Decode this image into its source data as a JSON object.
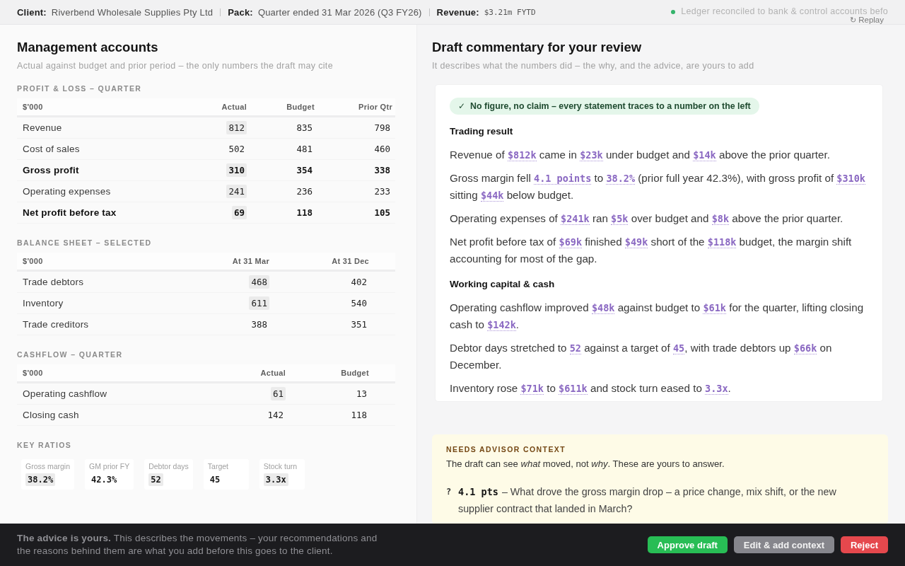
{
  "header": {
    "fields": [
      {
        "label": "Client:",
        "value": "Riverbend Wholesale Supplies Pty Ltd",
        "kind": "text"
      },
      {
        "label": "Pack:",
        "value": "Quarter ended 31 Mar 2026 (Q3 FY26)",
        "kind": "text"
      },
      {
        "label": "Revenue:",
        "value": "$3.21m FYTD",
        "kind": "mono"
      }
    ],
    "status": "Ledger reconciled to bank & control accounts befo",
    "replay": {
      "icon": "↻",
      "label": "Replay"
    }
  },
  "accounts": {
    "title": "Management accounts",
    "subtitle": "Actual against budget and prior period – the only numbers the draft may cite",
    "tables": [
      {
        "title": "PROFIT & LOSS – QUARTER",
        "stub_header": "$'000",
        "columns": [
          "Actual",
          "Budget",
          "Prior Qtr"
        ],
        "rows": [
          {
            "label": "Revenue",
            "kind": "line",
            "cells": [
              {
                "value": "812",
                "highlighted": true
              },
              {
                "value": "835",
                "highlighted": false
              },
              {
                "value": "798",
                "highlighted": false
              }
            ]
          },
          {
            "label": "Cost of sales",
            "kind": "line",
            "cells": [
              {
                "value": "502",
                "highlighted": false
              },
              {
                "value": "481",
                "highlighted": false
              },
              {
                "value": "460",
                "highlighted": false
              }
            ]
          },
          {
            "label": "Gross profit",
            "kind": "total",
            "cells": [
              {
                "value": "310",
                "highlighted": true
              },
              {
                "value": "354",
                "highlighted": false
              },
              {
                "value": "338",
                "highlighted": false
              }
            ]
          },
          {
            "label": "Operating expenses",
            "kind": "line",
            "cells": [
              {
                "value": "241",
                "highlighted": true
              },
              {
                "value": "236",
                "highlighted": false
              },
              {
                "value": "233",
                "highlighted": false
              }
            ]
          },
          {
            "label": "Net profit before tax",
            "kind": "total",
            "cells": [
              {
                "value": "69",
                "highlighted": true
              },
              {
                "value": "118",
                "highlighted": false
              },
              {
                "value": "105",
                "highlighted": false
              }
            ]
          }
        ]
      },
      {
        "title": "BALANCE SHEET – SELECTED",
        "stub_header": "$'000",
        "columns": [
          "At 31 Mar",
          "At 31 Dec"
        ],
        "rows": [
          {
            "label": "Trade debtors",
            "kind": "line",
            "cells": [
              {
                "value": "468",
                "highlighted": true
              },
              {
                "value": "402",
                "highlighted": false
              }
            ]
          },
          {
            "label": "Inventory",
            "kind": "line",
            "cells": [
              {
                "value": "611",
                "highlighted": true
              },
              {
                "value": "540",
                "highlighted": false
              }
            ]
          },
          {
            "label": "Trade creditors",
            "kind": "line",
            "cells": [
              {
                "value": "388",
                "highlighted": false
              },
              {
                "value": "351",
                "highlighted": false
              }
            ]
          }
        ]
      },
      {
        "title": "CASHFLOW – QUARTER",
        "stub_header": "$'000",
        "columns": [
          "Actual",
          "Budget"
        ],
        "rows": [
          {
            "label": "Operating cashflow",
            "kind": "line",
            "cells": [
              {
                "value": "61",
                "highlighted": true
              },
              {
                "value": "13",
                "highlighted": false
              }
            ]
          },
          {
            "label": "Closing cash",
            "kind": "line",
            "cells": [
              {
                "value": "142",
                "highlighted": false
              },
              {
                "value": "118",
                "highlighted": false
              }
            ]
          }
        ]
      }
    ],
    "ratios": {
      "title": "KEY RATIOS",
      "items": [
        {
          "label": "Gross margin",
          "value": "38.2%",
          "highlighted": true
        },
        {
          "label": "GM prior FY",
          "value": "42.3%",
          "highlighted": false
        },
        {
          "label": "Debtor days",
          "value": "52",
          "highlighted": true
        },
        {
          "label": "Target",
          "value": "45",
          "highlighted": false
        },
        {
          "label": "Stock turn",
          "value": "3.3x",
          "highlighted": true
        }
      ]
    }
  },
  "commentary": {
    "title": "Draft commentary for your review",
    "subtitle": "It describes what the numbers did – the why, and the advice, are yours to add",
    "badge": {
      "icon": "✓",
      "text": "No figure, no claim – every statement traces to a number on the left"
    },
    "sections": [
      {
        "heading": "Trading result",
        "paragraphs": [
          [
            {
              "kind": "text",
              "text": "Revenue of "
            },
            {
              "kind": "figure",
              "text": "$812k"
            },
            {
              "kind": "text",
              "text": " came in "
            },
            {
              "kind": "figure",
              "text": "$23k"
            },
            {
              "kind": "text",
              "text": " under budget and "
            },
            {
              "kind": "figure",
              "text": "$14k"
            },
            {
              "kind": "text",
              "text": " above the prior quarter."
            }
          ],
          [
            {
              "kind": "text",
              "text": "Gross margin fell "
            },
            {
              "kind": "figure",
              "text": "4.1 points"
            },
            {
              "kind": "text",
              "text": " to "
            },
            {
              "kind": "figure",
              "text": "38.2%"
            },
            {
              "kind": "text",
              "text": " (prior full year 42.3%), with gross profit of "
            },
            {
              "kind": "figure",
              "text": "$310k"
            },
            {
              "kind": "text",
              "text": " sitting "
            },
            {
              "kind": "figure",
              "text": "$44k"
            },
            {
              "kind": "text",
              "text": " below budget."
            }
          ],
          [
            {
              "kind": "text",
              "text": "Operating expenses of "
            },
            {
              "kind": "figure",
              "text": "$241k"
            },
            {
              "kind": "text",
              "text": " ran "
            },
            {
              "kind": "figure",
              "text": "$5k"
            },
            {
              "kind": "text",
              "text": " over budget and "
            },
            {
              "kind": "figure",
              "text": "$8k"
            },
            {
              "kind": "text",
              "text": " above the prior quarter."
            }
          ],
          [
            {
              "kind": "text",
              "text": "Net profit before tax of "
            },
            {
              "kind": "figure",
              "text": "$69k"
            },
            {
              "kind": "text",
              "text": " finished "
            },
            {
              "kind": "figure",
              "text": "$49k"
            },
            {
              "kind": "text",
              "text": " short of the "
            },
            {
              "kind": "figure",
              "text": "$118k"
            },
            {
              "kind": "text",
              "text": " budget, the margin shift accounting for most of the gap."
            }
          ]
        ]
      },
      {
        "heading": "Working capital & cash",
        "paragraphs": [
          [
            {
              "kind": "text",
              "text": "Operating cashflow improved "
            },
            {
              "kind": "figure",
              "text": "$48k"
            },
            {
              "kind": "text",
              "text": " against budget to "
            },
            {
              "kind": "figure",
              "text": "$61k"
            },
            {
              "kind": "text",
              "text": " for the quarter, lifting closing cash to "
            },
            {
              "kind": "figure",
              "text": "$142k"
            },
            {
              "kind": "text",
              "text": "."
            }
          ],
          [
            {
              "kind": "text",
              "text": "Debtor days stretched to "
            },
            {
              "kind": "figure",
              "text": "52"
            },
            {
              "kind": "text",
              "text": " against a target of "
            },
            {
              "kind": "figure",
              "text": "45"
            },
            {
              "kind": "text",
              "text": ", with trade debtors up "
            },
            {
              "kind": "figure",
              "text": "$66k"
            },
            {
              "kind": "text",
              "text": " on December."
            }
          ],
          [
            {
              "kind": "text",
              "text": "Inventory rose "
            },
            {
              "kind": "figure",
              "text": "$71k"
            },
            {
              "kind": "text",
              "text": " to "
            },
            {
              "kind": "figure",
              "text": "$611k"
            },
            {
              "kind": "text",
              "text": " and stock turn eased to "
            },
            {
              "kind": "figure",
              "text": "3.3x"
            },
            {
              "kind": "text",
              "text": "."
            }
          ]
        ]
      }
    ]
  },
  "advisor_context": {
    "title": "NEEDS ADVISOR CONTEXT",
    "intro": "The draft can see *what* moved, not *why*. These are yours to answer.",
    "questions": [
      {
        "marker": "?",
        "figure": "4.1 pts",
        "text": "– What drove the gross margin drop – a price change, mix shift, or the new supplier contract that landed in March?"
      }
    ]
  },
  "footer": {
    "note": "**The advice is yours.** This describes the movements – your recommendations and the reasons behind them are what you add before this goes to the client.",
    "buttons": [
      {
        "label": "Approve draft",
        "kind": "approve"
      },
      {
        "label": "Edit & add context",
        "kind": "edit"
      },
      {
        "label": "Reject",
        "kind": "reject"
      }
    ]
  }
}
